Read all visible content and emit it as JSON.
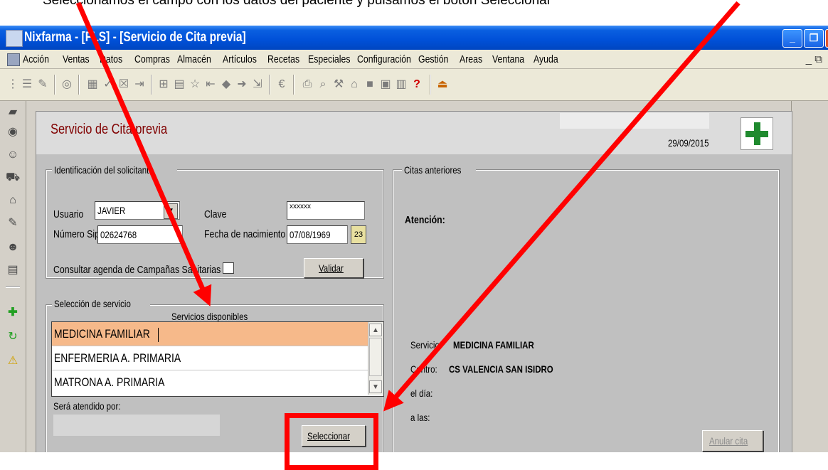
{
  "document_text": "Seleccionamos el campo con los datos del paciente y pulsamos el botón Seleccionar",
  "window": {
    "title": "Nixfarma - [FLS] - [Servicio de Cita previa]",
    "buttons": [
      "minimize-icon",
      "restore-icon",
      "close-icon"
    ]
  },
  "menu": {
    "items": [
      "Acción",
      "Ventas",
      "Datos",
      "Compras",
      "Almacén",
      "Artículos",
      "Recetas",
      "Especiales",
      "Configuración",
      "Gestión",
      "Areas",
      "Ventana",
      "Ayuda"
    ],
    "mdi_controls": "_ ⧉"
  },
  "form": {
    "title": "Servicio de Cita previa",
    "date": "29/09/2015",
    "identificacion": {
      "legend": "Identificación del solicitante",
      "usuario_label": "Usuario",
      "usuario_value": "JAVIER",
      "clave_label": "Clave",
      "clave_value": "xxxxxx",
      "sip_label": "Número Sip",
      "sip_value": "02624768",
      "nacimiento_label": "Fecha de nacimiento",
      "nacimiento_value": "07/08/1969",
      "calendar_glyph": "23",
      "consultar_label": "Consultar agenda de Campañas Sanitarias",
      "validar_label": "Validar"
    },
    "seleccion": {
      "legend": "Selección de servicio",
      "list_header": "Servicios disponibles",
      "services": [
        "MEDICINA FAMILIAR",
        "ENFERMERIA A. PRIMARIA",
        "MATRONA A. PRIMARIA"
      ],
      "selected_index": 0,
      "atendido_label": "Será atendido por:",
      "seleccionar_label": "Seleccionar"
    },
    "citas": {
      "legend": "Citas anteriores",
      "atencion_label": "Atención:",
      "servicio_label": "Servicio:",
      "servicio_value": "MEDICINA FAMILIAR",
      "centro_label": "Centro:",
      "centro_value": "CS VALENCIA SAN ISIDRO",
      "dia_label": "el día:",
      "hora_label": "a las:",
      "anular_label": "Anular cita"
    }
  },
  "colors": {
    "title_gradient": "#0050d8",
    "form_title": "#800000",
    "selection": "#f6b98a",
    "annotation": "#ff0000",
    "cross": "#1f8a2e"
  }
}
